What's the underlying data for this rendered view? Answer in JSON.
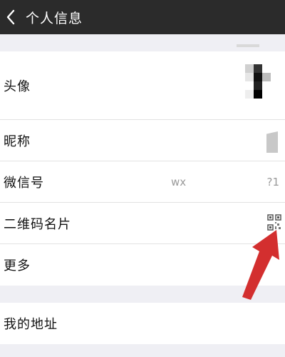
{
  "header": {
    "title": "个人信息",
    "back_icon": "back-arrow-icon"
  },
  "rows_main": [
    {
      "label": "头像"
    },
    {
      "label": "昵称"
    },
    {
      "label": "微信号",
      "value_prefix": "wx",
      "value_suffix": "?1"
    },
    {
      "label": "二维码名片"
    },
    {
      "label": "更多"
    }
  ],
  "rows_secondary": [
    {
      "label": "我的地址"
    }
  ],
  "colors": {
    "header_bg": "#2b2b2b",
    "page_bg": "#efeff4",
    "arrow": "#d32f2f"
  }
}
